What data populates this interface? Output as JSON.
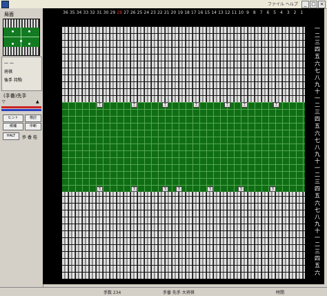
{
  "window": {
    "menu_text": "ファイル ヘルプ",
    "min_label": "_",
    "max_label": "□",
    "close_label": "×"
  },
  "side": {
    "minimap_label": "局面",
    "panel_lines": [
      "一 一",
      "将棋",
      "後手 持駒",
      "(手番)先手"
    ],
    "arrow_up": "▲",
    "arrow_down": "▽",
    "buttons": [
      "検討",
      "ヒント",
      "候補",
      "中断"
    ],
    "halt_label": "HALT",
    "glyphs": [
      "歩",
      "香",
      "桂"
    ]
  },
  "board": {
    "columns": [
      "36",
      "35",
      "34",
      "33",
      "32",
      "31",
      "30",
      "29",
      "28",
      "27",
      "26",
      "25",
      "24",
      "23",
      "22",
      "21",
      "20",
      "19",
      "18",
      "17",
      "16",
      "15",
      "14",
      "13",
      "12",
      "11",
      "10",
      "9",
      "8",
      "7",
      "6",
      "5",
      "4",
      "3",
      "2",
      "1"
    ],
    "highlight_column": "28",
    "ranks": [
      "一",
      "二",
      "三",
      "四",
      "五",
      "六",
      "七",
      "八",
      "九",
      "十",
      "一",
      "二",
      "三",
      "四",
      "五",
      "六",
      "七",
      "八",
      "九",
      "十",
      "一",
      "二",
      "三",
      "四",
      "五",
      "六",
      "七",
      "八",
      "九",
      "十",
      "一",
      "二",
      "三",
      "四",
      "五",
      "六"
    ],
    "top_marker_label": "王",
    "bottom_marker_label": "玉"
  },
  "status": {
    "left_text": "手数 234",
    "center_text": "手番 先手 大将棋",
    "right_text": "時間"
  }
}
